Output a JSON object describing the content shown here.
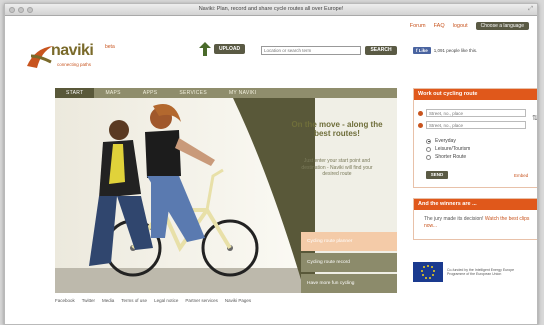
{
  "window": {
    "title": "Naviki: Plan, record and share cycle routes all over Europe!"
  },
  "toplinks": {
    "forum": "Forum",
    "faq": "FAQ",
    "logout": "logout",
    "language": "Choose a language"
  },
  "logo": {
    "name": "naviki",
    "beta": "beta",
    "tagline": "connecting paths"
  },
  "header": {
    "upload_label": "UPLOAD",
    "search_placeholder": "Location or search term",
    "search_label": "SEARCH"
  },
  "facebook": {
    "like_label": "Like",
    "count_text": "1,091 people like this."
  },
  "nav": {
    "items": [
      "START",
      "MAPS",
      "APPS",
      "SERVICES",
      "MY NAVIKI"
    ]
  },
  "hero": {
    "title": "On the move - along the best routes!",
    "text": "Just enter your start point and destination - Naviki will find your desired route",
    "tabs": [
      "Cycling route planner",
      "Cycling route record",
      "Have more fun cycling"
    ]
  },
  "route_box": {
    "title": "Work out cycling route",
    "from_placeholder": "Street, no., place",
    "to_placeholder": "Street, no., place",
    "options": [
      "Everyday",
      "Leisure/Tourism",
      "Shorter Route"
    ],
    "selected": "Everyday",
    "send_label": "SEND",
    "embed_label": "Embed"
  },
  "winners_box": {
    "title": "And the winners are ...",
    "text": "The jury made its decision!",
    "link": "Watch the best clips now..."
  },
  "eu": {
    "text": "Co-funded by the Intelligent Energy Europe Programme of the European Union"
  },
  "footer": {
    "links": [
      "Facebook",
      "Twitter",
      "Media",
      "Terms of use",
      "Legal notice",
      "Partner services",
      "Naviki Pages"
    ]
  },
  "colors": {
    "accent": "#e0581b",
    "olive": "#8f8d6c",
    "dark_olive": "#5a5a44"
  }
}
